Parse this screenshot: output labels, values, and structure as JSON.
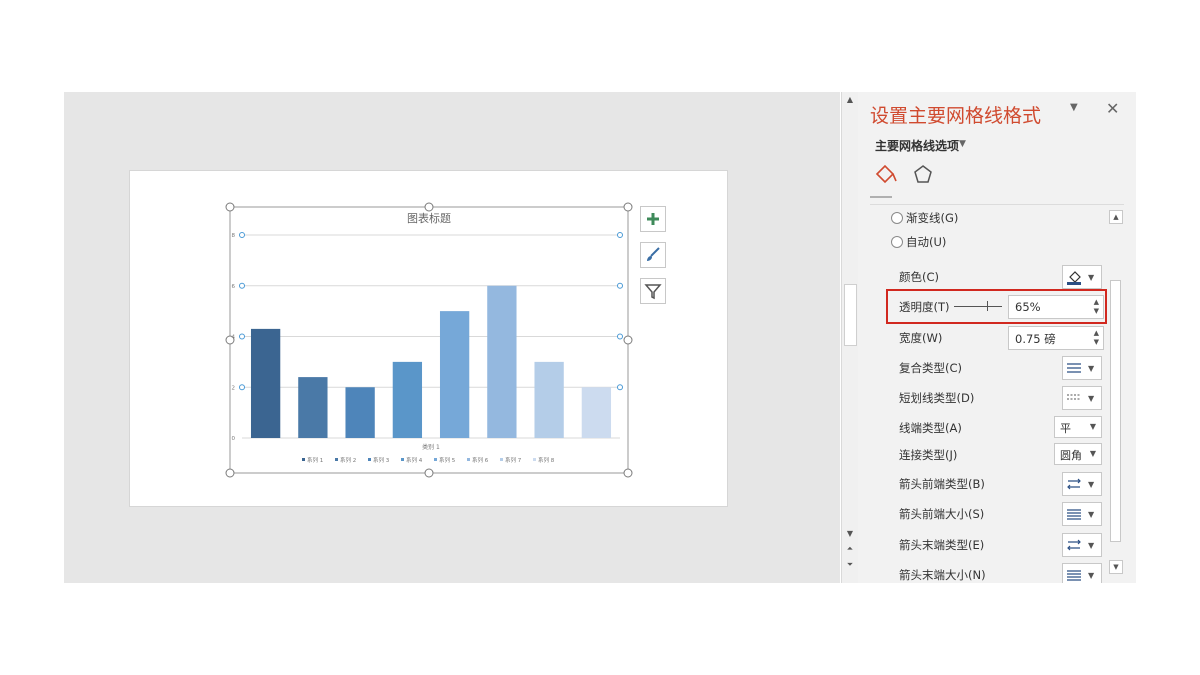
{
  "chart": {
    "title": "图表标题",
    "category_label": "类别 1",
    "tools": {
      "add_icon": "plus-icon",
      "style_icon": "brush-icon",
      "filter_icon": "filter-icon"
    }
  },
  "chart_data": {
    "type": "bar",
    "title": "图表标题",
    "categories": [
      "类别 1"
    ],
    "series": [
      {
        "name": "系列 1",
        "values": [
          4.3
        ],
        "color": "#3b6591"
      },
      {
        "name": "系列 2",
        "values": [
          2.4
        ],
        "color": "#4a79a7"
      },
      {
        "name": "系列 3",
        "values": [
          2.0
        ],
        "color": "#4e85ba"
      },
      {
        "name": "系列 4",
        "values": [
          3.0
        ],
        "color": "#5a96c9"
      },
      {
        "name": "系列 5",
        "values": [
          5.0
        ],
        "color": "#76a8d8"
      },
      {
        "name": "系列 6",
        "values": [
          6.0
        ],
        "color": "#94b8df"
      },
      {
        "name": "系列 7",
        "values": [
          3.0
        ],
        "color": "#b4cde8"
      },
      {
        "name": "系列 8",
        "values": [
          2.0
        ],
        "color": "#ccdbef"
      }
    ],
    "y_ticks": [
      "0",
      "2",
      "4",
      "6",
      "8"
    ],
    "ylim": [
      0,
      8
    ],
    "grid": true,
    "legend_position": "bottom"
  },
  "pane": {
    "title": "设置主要网格线格式",
    "subtitle": "主要网格线选项",
    "tabs": [
      "fill-line-icon",
      "pentagon-icon"
    ],
    "radios": [
      {
        "label": "渐变线(G)"
      },
      {
        "label": "自动(U)"
      }
    ],
    "color_label": "颜色(C)",
    "transparency_label": "透明度(T)",
    "transparency_value": "65%",
    "transparency_percent": 65,
    "width_label": "宽度(W)",
    "width_value": "0.75 磅",
    "compound_label": "复合类型(C)",
    "dash_label": "短划线类型(D)",
    "cap_label": "线端类型(A)",
    "cap_value": "平",
    "join_label": "连接类型(J)",
    "join_value": "圆角",
    "arrow_begin_type_label": "箭头前端类型(B)",
    "arrow_begin_size_label": "箭头前端大小(S)",
    "arrow_end_type_label": "箭头末端类型(E)",
    "arrow_end_size_label": "箭头末端大小(N)"
  },
  "colors": {
    "accent_title": "#d04a2f",
    "highlight_border": "#d1281f"
  }
}
